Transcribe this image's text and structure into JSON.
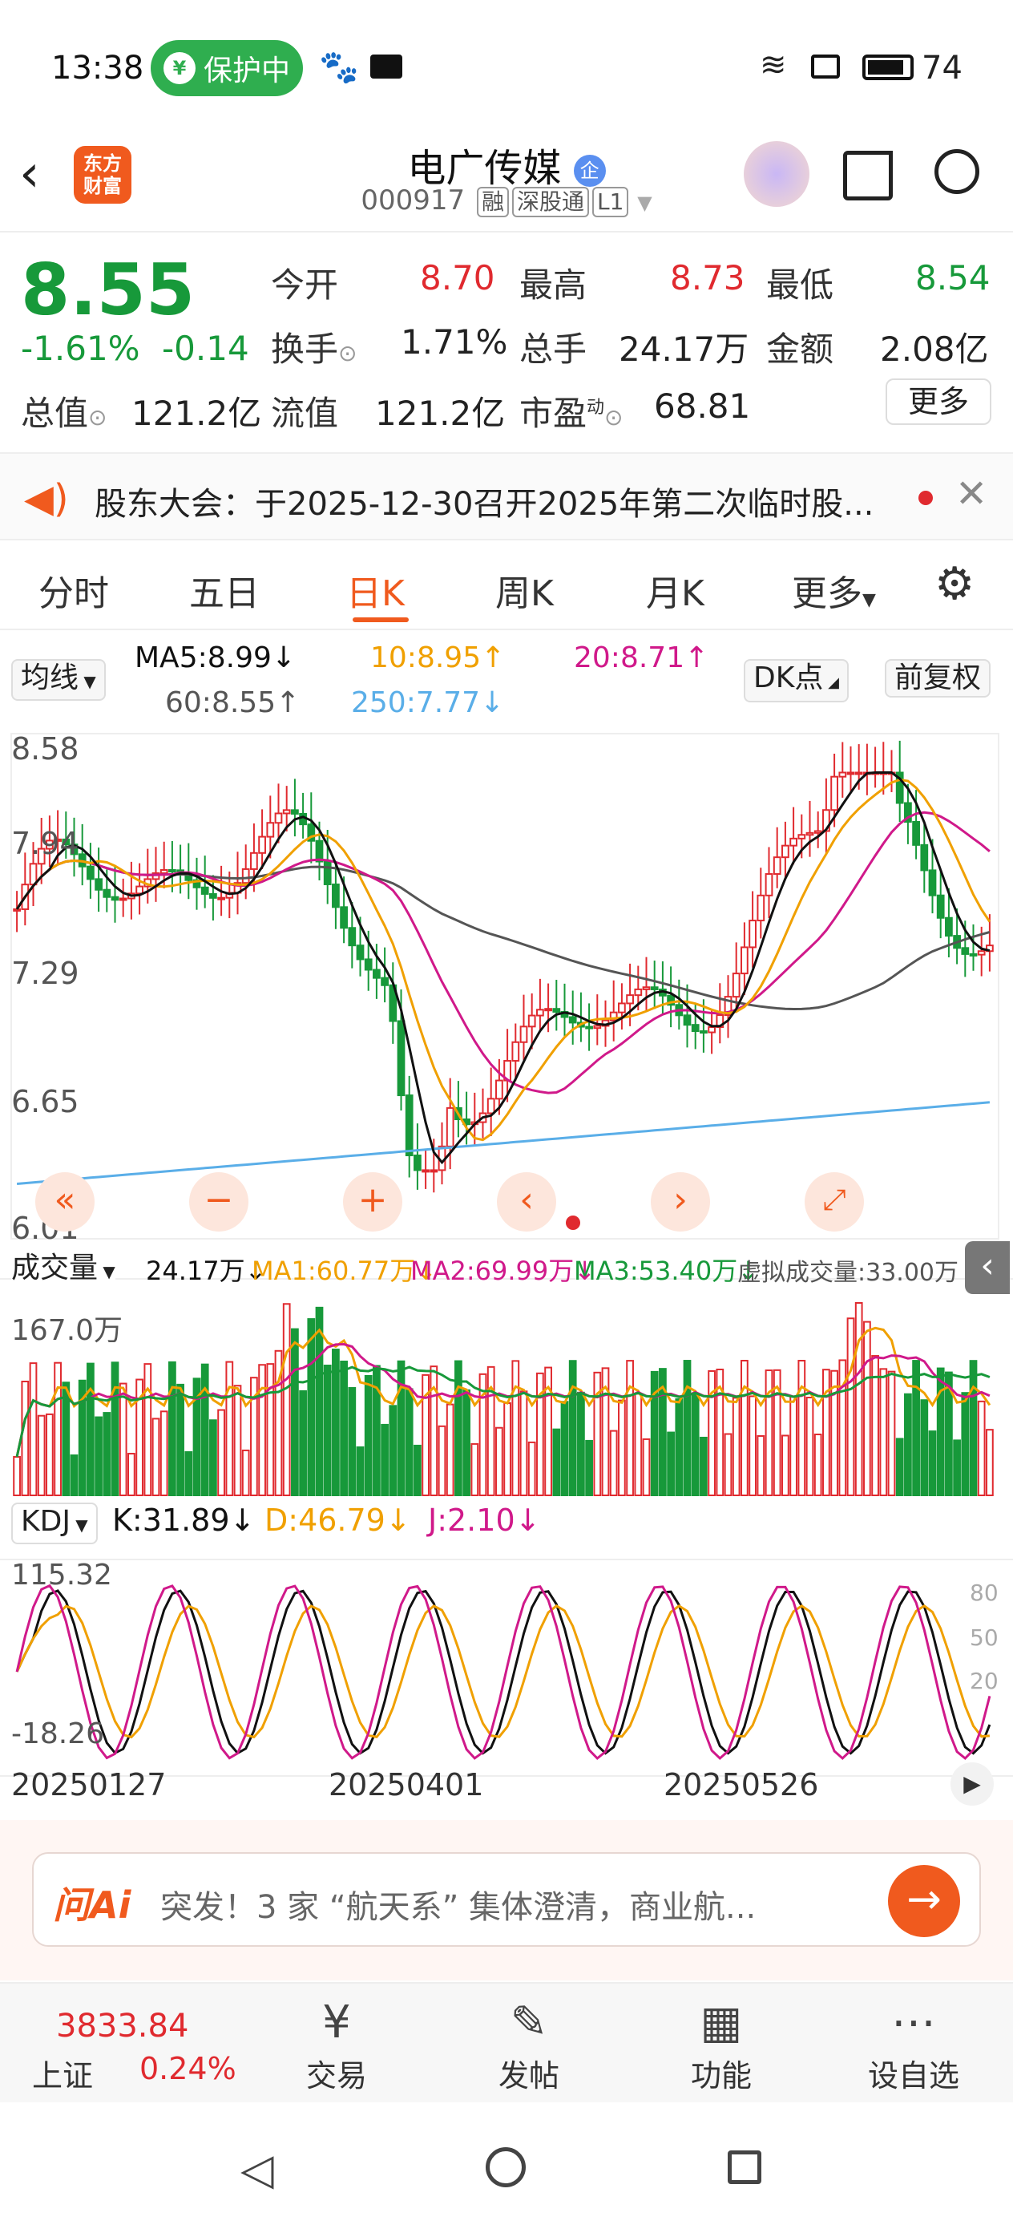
{
  "status_bar": {
    "time": "13:38",
    "protection": "保护中",
    "battery": "74"
  },
  "header": {
    "title": "电广传媒",
    "title_badge": "企",
    "code": "000917",
    "tags": [
      "融",
      "深股通",
      "L1"
    ],
    "logo_line1": "东方",
    "logo_line2": "财富"
  },
  "quote": {
    "price": "8.55",
    "change_pct": "-1.61%",
    "change": "-0.14",
    "open_label": "今开",
    "open": "8.70",
    "high_label": "最高",
    "high": "8.73",
    "low_label": "最低",
    "low": "8.54",
    "turnover_label": "换手",
    "turnover": "1.71%",
    "volume_label": "总手",
    "volume": "24.17万",
    "amount_label": "金额",
    "amount": "2.08亿",
    "mktcap_label": "总值",
    "mktcap": "121.2亿",
    "float_label": "流值",
    "float_cap": "121.2亿",
    "pe_label": "市盈",
    "pe_sup": "动",
    "pe": "68.81",
    "more": "更多"
  },
  "notice": {
    "text": "股东大会：于2025-12-30召开2025年第二次临时股..."
  },
  "tabs": [
    "分时",
    "五日",
    "日K",
    "周K",
    "月K",
    "更多"
  ],
  "active_tab": "日K",
  "kline": {
    "selector": "均线",
    "ma5": "MA5:8.99↓",
    "ma10": "10:8.95↑",
    "ma20": "20:8.71↑",
    "ma60": "60:8.55↑",
    "ma250": "250:7.77↓",
    "dk": "DK点",
    "adjust": "前复权",
    "y_ticks": [
      "8.58",
      "7.94",
      "7.29",
      "6.65",
      "6.01"
    ]
  },
  "volume": {
    "selector": "成交量",
    "vol": "24.17万↓",
    "ma1": "MA1:60.77万↓",
    "ma2": "MA2:69.99万↓",
    "ma3": "MA3:53.40万↓",
    "virtual": "虚拟成交量:33.00万",
    "max": "167.0万"
  },
  "kdj": {
    "selector": "KDJ",
    "k": "K:31.89↓",
    "d": "D:46.79↓",
    "j": "J:2.10↓",
    "max": "115.32",
    "min": "-18.26",
    "levels": [
      "80",
      "50",
      "20"
    ]
  },
  "dates": [
    "20250127",
    "20250401",
    "20250526"
  ],
  "ai": {
    "brand": "问Ai",
    "text": "突发！3 家 “航天系” 集体澄清，商业航..."
  },
  "bottom_nav": {
    "index_value": "3833.84",
    "index_name": "上证",
    "index_change": "0.24%",
    "items": [
      "交易",
      "发帖",
      "功能",
      "设自选"
    ]
  },
  "colors": {
    "up": "#e02a2f",
    "down": "#17993a",
    "accent": "#f05a1e",
    "ma5": "#111111",
    "ma10": "#f0a000",
    "ma20": "#d0198a",
    "ma60": "#555555",
    "ma250": "#5aaee8"
  }
}
